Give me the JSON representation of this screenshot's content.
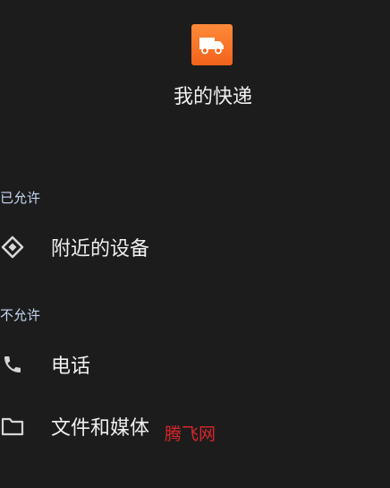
{
  "app": {
    "name": "我的快递",
    "icon": "delivery-truck-icon",
    "accent": "#f46a20"
  },
  "sections": {
    "allowed": {
      "label": "已允许",
      "items": [
        {
          "label": "附近的设备",
          "icon": "nearby-devices-icon"
        }
      ]
    },
    "denied": {
      "label": "不允许",
      "items": [
        {
          "label": "电话",
          "icon": "phone-icon"
        },
        {
          "label": "文件和媒体",
          "icon": "folder-icon"
        }
      ]
    }
  },
  "watermark": "腾飞网"
}
